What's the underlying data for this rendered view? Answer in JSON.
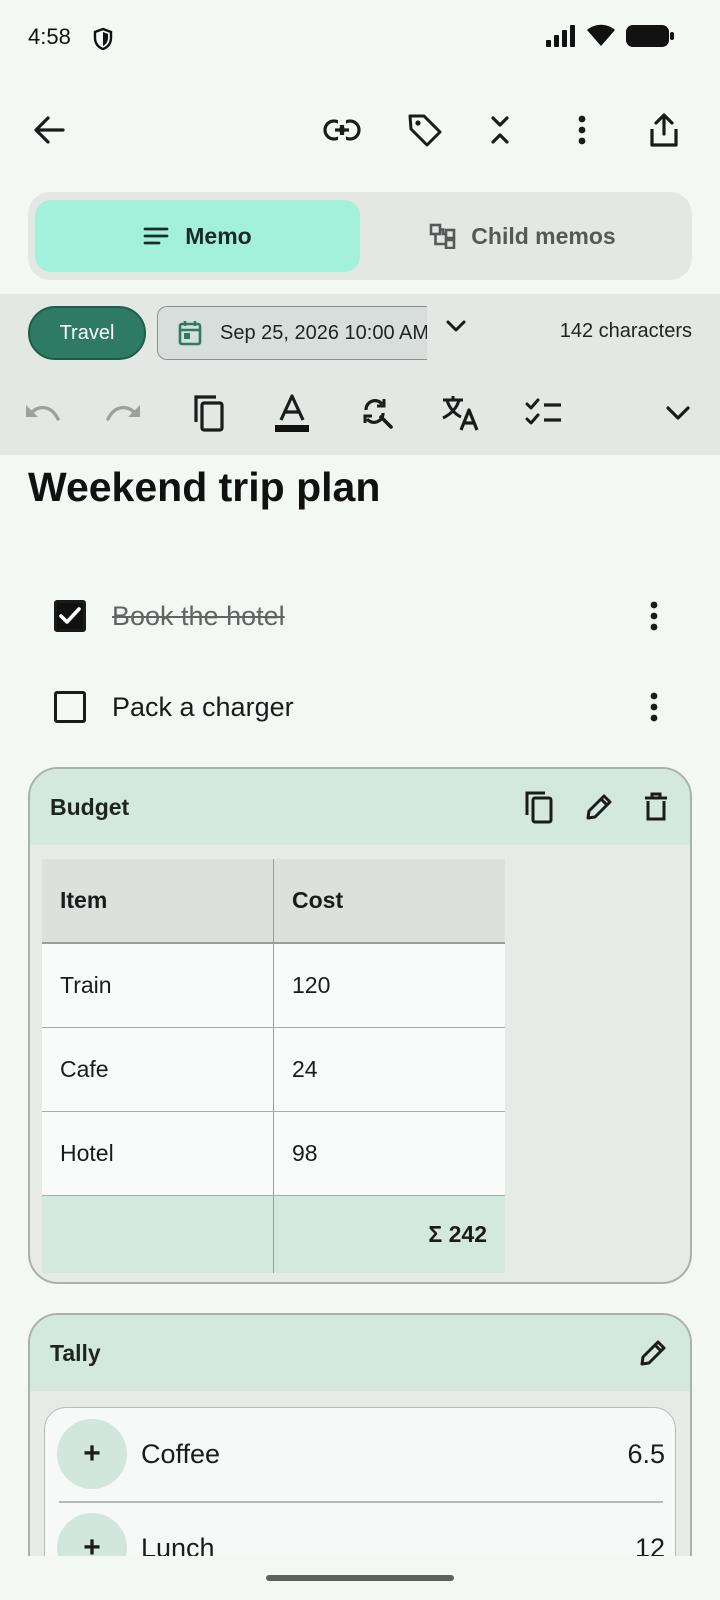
{
  "status_bar": {
    "time": "4:58"
  },
  "tabs": {
    "memo": "Memo",
    "child": "Child memos"
  },
  "meta": {
    "tag": "Travel",
    "date": "Sep 25, 2026 10:00 AM",
    "char_count": "142 characters"
  },
  "memo": {
    "title": "Weekend trip plan",
    "checklist": [
      {
        "text": "Book the hotel",
        "checked": true
      },
      {
        "text": "Pack a charger",
        "checked": false
      }
    ]
  },
  "budget": {
    "title": "Budget",
    "headers": [
      "Item",
      "Cost"
    ],
    "rows": [
      [
        "Train",
        "120"
      ],
      [
        "Cafe",
        "24"
      ],
      [
        "Hotel",
        "98"
      ]
    ],
    "sum": "Σ 242"
  },
  "tally": {
    "title": "Tally",
    "items": [
      {
        "plus": "+",
        "name": "Coffee",
        "value": "6.5"
      },
      {
        "plus": "+",
        "name": "Lunch",
        "value": "12"
      }
    ]
  },
  "icons": [
    "back-arrow-icon",
    "link-icon",
    "tag-icon",
    "collapse-icon",
    "more-vert-icon",
    "share-icon",
    "memo-lines-icon",
    "child-tree-icon",
    "calendar-icon",
    "chevron-down-icon",
    "undo-icon",
    "redo-icon",
    "copy-icon",
    "text-color-icon",
    "find-replace-icon",
    "translate-icon",
    "checklist-icon",
    "edit-icon",
    "delete-icon",
    "shield-icon",
    "signal-icon",
    "wifi-icon",
    "battery-icon"
  ],
  "colors": {
    "accent": "#a3f1da",
    "tag": "#2e7a63",
    "card_header": "#d3e8df",
    "background": "#f3f8f5"
  }
}
